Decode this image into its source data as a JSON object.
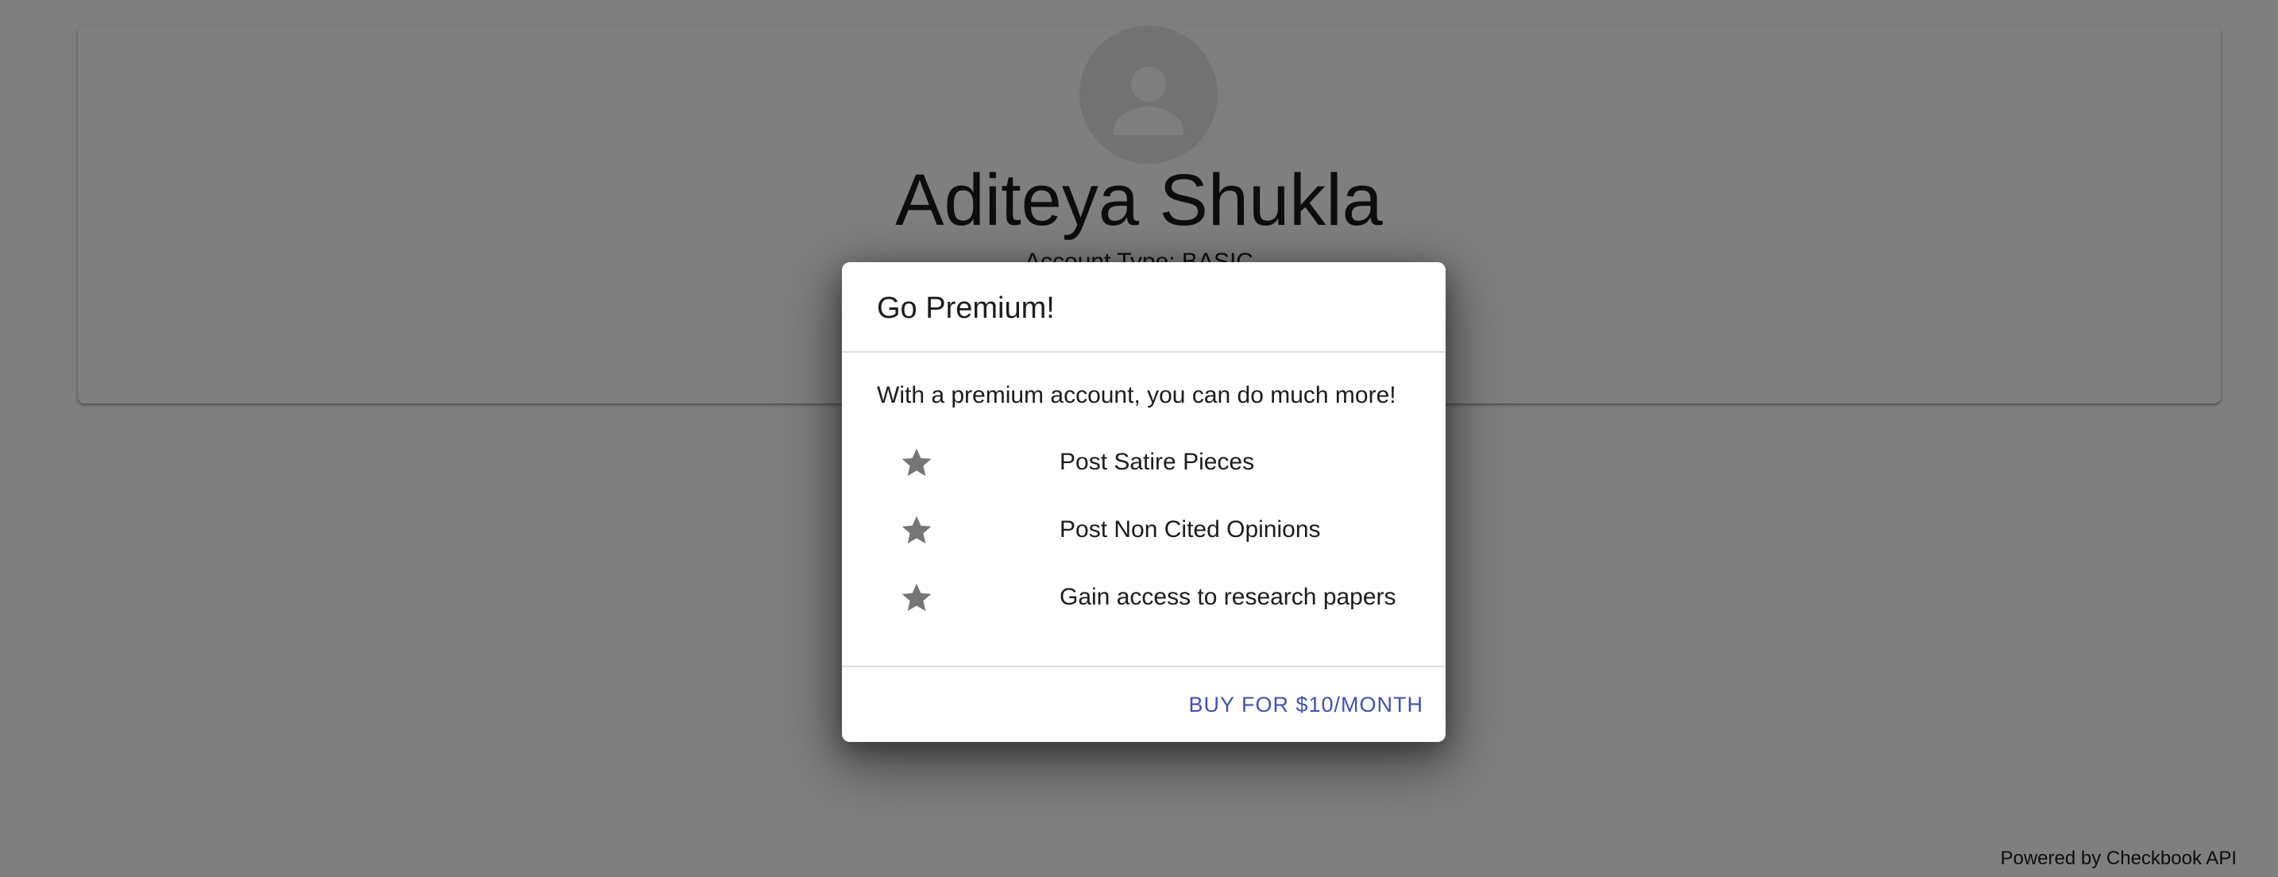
{
  "profile": {
    "name": "Aditeya Shukla",
    "account_type": "Account Type: BASIC",
    "avatar_icon": "person-icon"
  },
  "footer": {
    "powered_by": "Powered by Checkbook API"
  },
  "modal": {
    "title": "Go Premium!",
    "intro": "With a premium account, you can do much more!",
    "features": [
      {
        "icon": "star-icon",
        "label": "Post Satire Pieces"
      },
      {
        "icon": "star-icon",
        "label": "Post Non Cited Opinions"
      },
      {
        "icon": "star-icon",
        "label": "Gain access to research papers"
      }
    ],
    "buy_label": "BUY FOR $10/MONTH"
  },
  "colors": {
    "accent": "#3f51b5",
    "backdrop": "rgba(0,0,0,0.5)",
    "icon_gray": "#757575"
  }
}
